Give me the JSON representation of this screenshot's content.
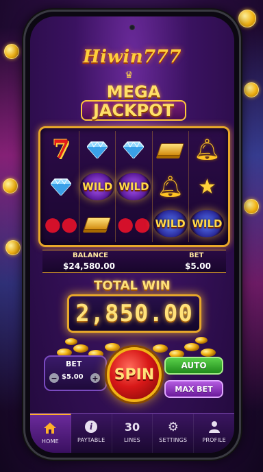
{
  "app": {
    "logo_text": "Hiwin777"
  },
  "jackpot": {
    "line1": "MEGA",
    "line2": "JACKPOT"
  },
  "reels": {
    "rows": [
      [
        "seven",
        "diamond",
        "diamond",
        "gold-bar",
        "bell"
      ],
      [
        "diamond",
        "wild",
        "wild",
        "bell",
        "star"
      ],
      [
        "cherry",
        "gold-bar",
        "cherry",
        "wild",
        "wild"
      ]
    ],
    "seven_label": "7",
    "wild_label": "WILD"
  },
  "stats": {
    "balance_label": "BALANCE",
    "balance_value": "$24,580.00",
    "bet_label": "BET",
    "bet_value": "$5.00"
  },
  "win": {
    "title": "TOTAL WIN",
    "value": "2,850.00"
  },
  "controls": {
    "bet_label": "BET",
    "bet_amount": "$5.00",
    "minus": "−",
    "plus": "+",
    "spin_label": "SPIN",
    "auto_label": "AUTO",
    "max_bet_label": "MAX BET"
  },
  "nav": {
    "items": [
      {
        "label": "HOME",
        "icon": "home-icon",
        "active": true
      },
      {
        "label": "PAYTABLE",
        "icon": "info-icon",
        "active": false
      },
      {
        "label": "LINES",
        "icon": "lines-count",
        "value": "30",
        "active": false
      },
      {
        "label": "SETTINGS",
        "icon": "gear-icon",
        "active": false
      },
      {
        "label": "PROFILE",
        "icon": "user-icon",
        "active": false
      }
    ]
  },
  "colors": {
    "accent_gold": "#e7a72a",
    "spin_red": "#d81818",
    "auto_green": "#1f8a1a",
    "maxbet_purple": "#6a1a9a",
    "nav_active": "#ffb02a"
  }
}
